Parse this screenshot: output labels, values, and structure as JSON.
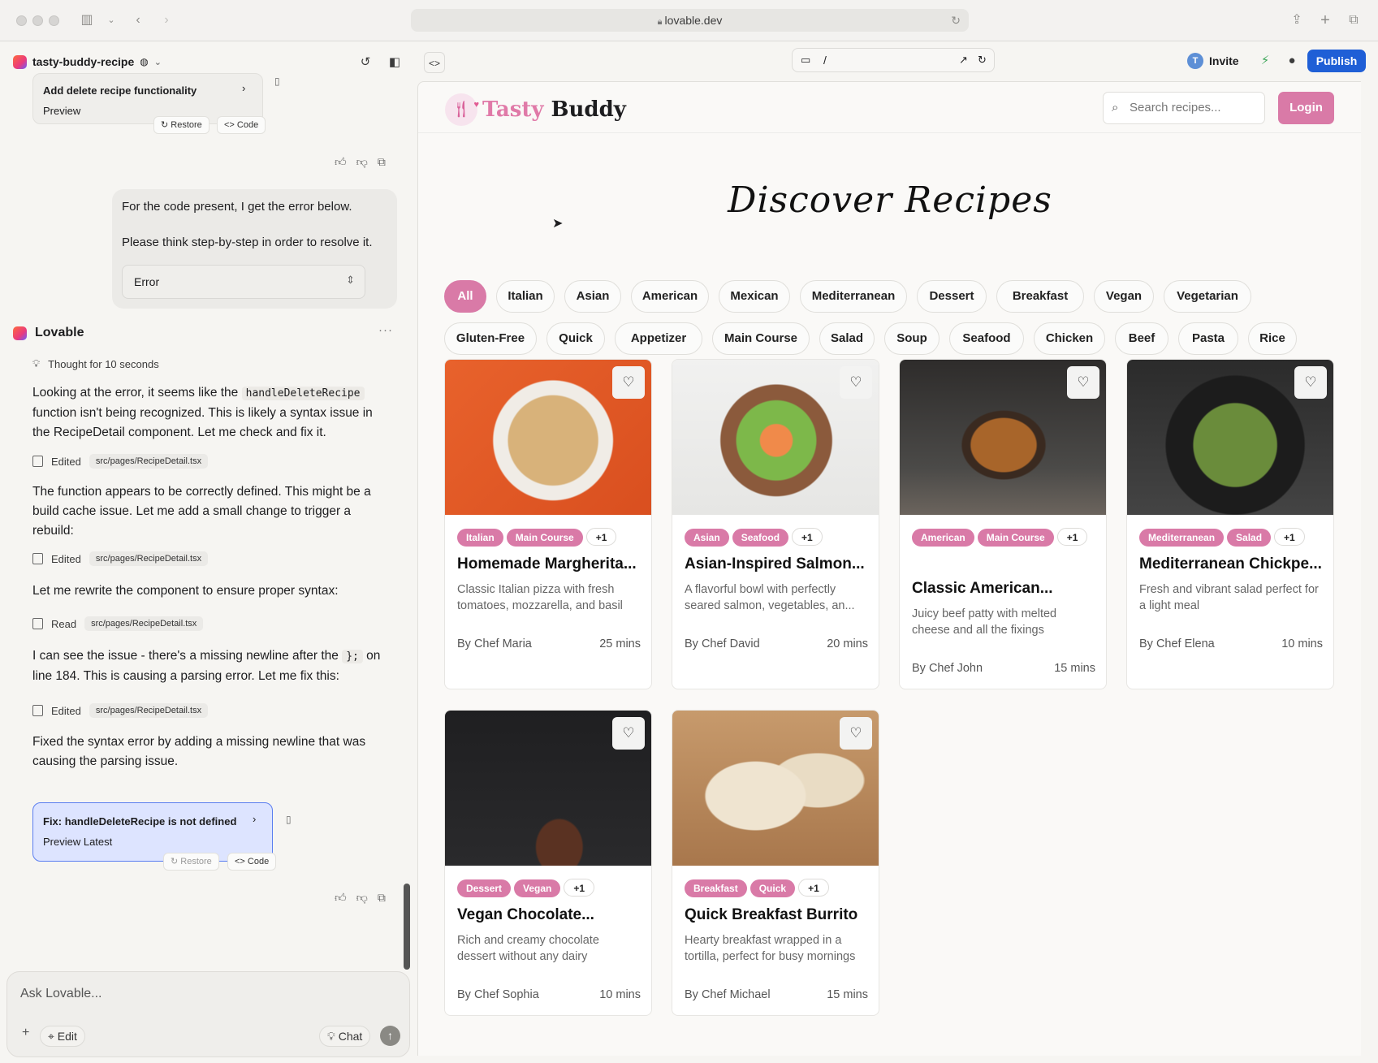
{
  "browser": {
    "url": "lovable.dev"
  },
  "project": {
    "name": "tasty-buddy-recipe"
  },
  "toolbar": {
    "preview_path": "/",
    "invite": "Invite",
    "invite_avatar": "T",
    "publish": "Publish"
  },
  "chat": {
    "prev_card": {
      "title": "Add delete recipe functionality",
      "sub": "Preview",
      "restore": "Restore",
      "code": "Code"
    },
    "user_msg": {
      "line1": "For the code present, I get the error below.",
      "line2": "Please think step-by-step in order to resolve it.",
      "error_label": "Error"
    },
    "assistant": {
      "name": "Lovable",
      "thought": "Thought for 10 seconds"
    },
    "p1a": "Looking at the error, it seems like the",
    "p1code": "handleDeleteRecipe",
    "p1b": "function isn't being recognized. This is likely a syntax issue in the RecipeDetail component. Let me check and fix it.",
    "edited": "Edited",
    "read": "Read",
    "file": "src/pages/RecipeDetail.tsx",
    "p2": "The function appears to be correctly defined. This might be a build cache issue. Let me add a small change to trigger a rebuild:",
    "p3": "Let me rewrite the component to ensure proper syntax:",
    "p4a": "I can see the issue - there's a missing newline after the",
    "p4code": "};",
    "p4b": "on line 184. This is causing a parsing error. Let me fix this:",
    "p5": "Fixed the syntax error by adding a missing newline that was causing the parsing issue.",
    "fix_card": {
      "title": "Fix: handleDeleteRecipe is not defined",
      "sub": "Preview Latest",
      "restore": "Restore",
      "code": "Code"
    },
    "composer": {
      "placeholder": "Ask Lovable...",
      "edit": "Edit",
      "chat": "Chat"
    }
  },
  "site": {
    "brand_a": "Tasty",
    "brand_b": "Buddy",
    "search_placeholder": "Search recipes...",
    "login": "Login",
    "hero": "Discover Recipes",
    "filters": [
      "All",
      "Italian",
      "Asian",
      "American",
      "Mexican",
      "Mediterranean",
      "Dessert",
      "Breakfast",
      "Vegan",
      "Vegetarian",
      "Gluten-Free",
      "Quick",
      "Appetizer",
      "Main Course",
      "Salad",
      "Soup",
      "Seafood",
      "Chicken",
      "Beef",
      "Pasta",
      "Rice"
    ],
    "active_filter": "All",
    "recipes": [
      {
        "tags": [
          "Italian",
          "Main Course"
        ],
        "more": "+1",
        "title": "Homemade Margherita...",
        "desc": "Classic Italian pizza with fresh tomatoes, mozzarella, and basil",
        "chef": "By Chef Maria",
        "time": "25 mins"
      },
      {
        "tags": [
          "Asian",
          "Seafood"
        ],
        "more": "+1",
        "title": "Asian-Inspired Salmon...",
        "desc": "A flavorful bowl with perfectly seared salmon, vegetables, an...",
        "chef": "By Chef David",
        "time": "20 mins"
      },
      {
        "tags": [
          "American",
          "Main Course"
        ],
        "more": "+1",
        "title": "Classic American...",
        "desc": "Juicy beef patty with melted cheese and all the fixings",
        "chef": "By Chef John",
        "time": "15 mins"
      },
      {
        "tags": [
          "Mediterranean",
          "Salad"
        ],
        "more": "+1",
        "title": "Mediterranean Chickpe...",
        "desc": "Fresh and vibrant salad perfect for a light meal",
        "chef": "By Chef Elena",
        "time": "10 mins"
      },
      {
        "tags": [
          "Dessert",
          "Vegan"
        ],
        "more": "+1",
        "title": "Vegan Chocolate...",
        "desc": "Rich and creamy chocolate dessert without any dairy",
        "chef": "By Chef Sophia",
        "time": "10 mins"
      },
      {
        "tags": [
          "Breakfast",
          "Quick"
        ],
        "more": "+1",
        "title": "Quick Breakfast Burrito",
        "desc": "Hearty breakfast wrapped in a tortilla, perfect for busy mornings",
        "chef": "By Chef Michael",
        "time": "15 mins"
      }
    ]
  },
  "colors": {
    "accent": "#d97aa7",
    "publish": "#1f5fd6"
  }
}
